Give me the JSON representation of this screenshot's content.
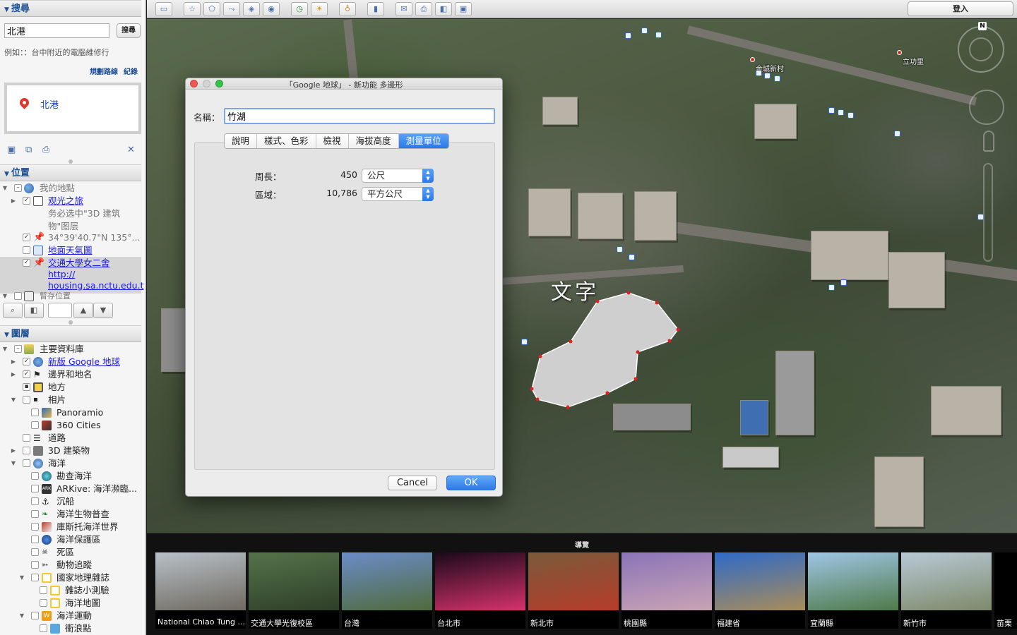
{
  "search": {
    "section_title": "搜尋",
    "query": "北港",
    "button": "搜尋",
    "example": "例如：：台中附近的電腦維修行",
    "links": [
      "規劃路線",
      "紀錄"
    ],
    "result": "北港"
  },
  "places": {
    "section_title": "位置",
    "items": [
      {
        "label": "我的地點"
      },
      {
        "label": "观光之旅"
      },
      {
        "label": "务必选中\"3D 建筑"
      },
      {
        "label": "物\"图层"
      },
      {
        "label": "34°39'40.7\"N 135°..."
      },
      {
        "label": "地面天氣圖"
      },
      {
        "label": "交通大學女二舍"
      },
      {
        "label": "http://"
      },
      {
        "label": "housing.sa.nctu.edu.t"
      },
      {
        "label": "暫存位置"
      }
    ]
  },
  "layers": {
    "section_title": "圖層",
    "items": [
      {
        "label": "主要資料庫"
      },
      {
        "label": "新版 Google 地球"
      },
      {
        "label": "邊界和地名"
      },
      {
        "label": "地方"
      },
      {
        "label": "相片"
      },
      {
        "label": "Panoramio"
      },
      {
        "label": "360 Cities"
      },
      {
        "label": "道路"
      },
      {
        "label": "3D 建築物"
      },
      {
        "label": "海洋"
      },
      {
        "label": "勘查海洋"
      },
      {
        "label": "ARKive: 海洋瀕臨..."
      },
      {
        "label": "沉船"
      },
      {
        "label": "海洋生物普查"
      },
      {
        "label": "庫斯托海洋世界"
      },
      {
        "label": "海洋保護區"
      },
      {
        "label": "死區"
      },
      {
        "label": "動物追蹤"
      },
      {
        "label": "國家地理雜誌"
      },
      {
        "label": "雜誌小測驗"
      },
      {
        "label": "海洋地圖"
      },
      {
        "label": "海洋運動"
      },
      {
        "label": "衝浪點"
      }
    ]
  },
  "toolbar": {
    "signin": "登入"
  },
  "map": {
    "labels": [
      "金城新村",
      "立功里"
    ],
    "overlay_text": "文字",
    "compass_n": "N"
  },
  "dialog": {
    "title": "「Google 地球」 - 新功能 多邊形",
    "name_label": "名稱：",
    "name_value": "竹湖",
    "tabs": [
      "說明",
      "樣式、色彩",
      "檢視",
      "海拔高度",
      "測量單位"
    ],
    "active_tab": "測量單位",
    "perimeter_label": "周長：",
    "perimeter_value": "450",
    "perimeter_unit": "公尺",
    "area_label": "區域：",
    "area_value": "10,786",
    "area_unit": "平方公尺",
    "cancel": "Cancel",
    "ok": "OK"
  },
  "tour": {
    "title": "導覽",
    "items": [
      {
        "caption": "National Chiao Tung ...",
        "color1": "#b8c0c8",
        "color2": "#6f6a60"
      },
      {
        "caption": "交通大學光復校區",
        "color1": "#55734a",
        "color2": "#2e3f28"
      },
      {
        "caption": "台灣",
        "color1": "#6b8cc9",
        "color2": "#4f6b3c"
      },
      {
        "caption": "台北市",
        "color1": "#1a0a18",
        "color2": "#d6326d"
      },
      {
        "caption": "新北市",
        "color1": "#7a5a3a",
        "color2": "#b63c2b"
      },
      {
        "caption": "桃園縣",
        "color1": "#8b74b8",
        "color2": "#c9a3b4"
      },
      {
        "caption": "福建省",
        "color1": "#2f6ac8",
        "color2": "#a88c5a"
      },
      {
        "caption": "宜蘭縣",
        "color1": "#9fc6e6",
        "color2": "#4f7a49"
      },
      {
        "caption": "新竹市",
        "color1": "#b8c9d6",
        "color2": "#7d8a6a"
      },
      {
        "caption": "苗栗"
      }
    ]
  }
}
